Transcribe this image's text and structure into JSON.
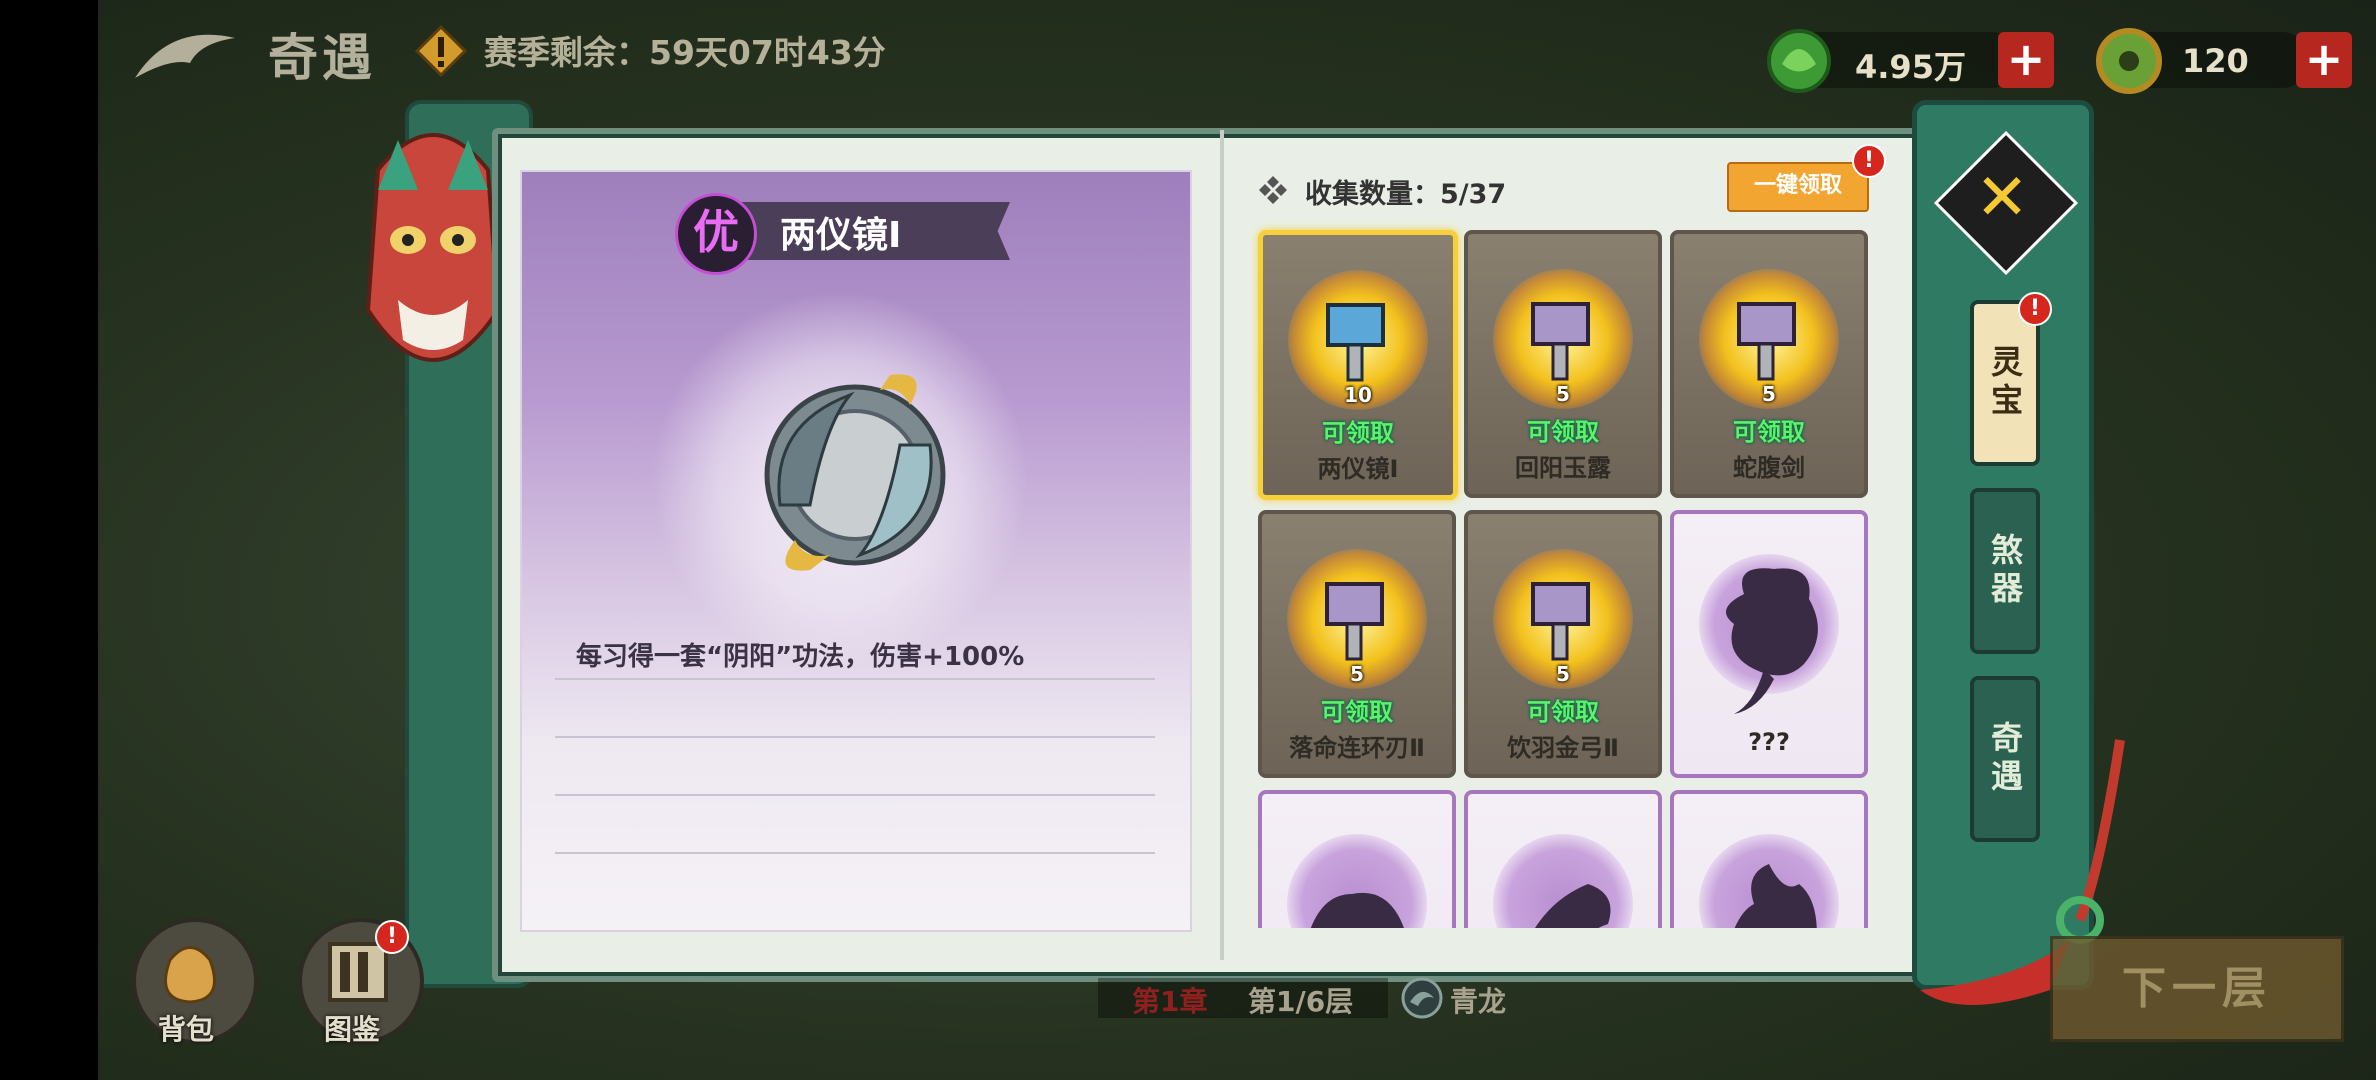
{
  "hud": {
    "title": "奇遇",
    "season_text": "赛季剩余：59天07时43分",
    "currency1": "4.95万",
    "currency2": "120",
    "plus": "+"
  },
  "detail": {
    "rank": "优",
    "name": "两仪镜Ⅰ",
    "description": "每习得一套“阴阳”功法，伤害+100%"
  },
  "collection": {
    "label": "收集数量：",
    "count": "5/37",
    "claim_all": "一键领取",
    "badge": "!"
  },
  "cards": [
    {
      "name": "两仪镜Ⅰ",
      "count": "10",
      "status": "可领取",
      "state": "owned"
    },
    {
      "name": "回阳玉露",
      "count": "5",
      "status": "可领取",
      "state": "owned"
    },
    {
      "name": "蛇腹剑",
      "count": "5",
      "status": "可领取",
      "state": "owned"
    },
    {
      "name": "落命连环刃Ⅱ",
      "count": "5",
      "status": "可领取",
      "state": "owned"
    },
    {
      "name": "饮羽金弓Ⅱ",
      "count": "5",
      "status": "可领取",
      "state": "owned"
    },
    {
      "name": "???",
      "state": "locked"
    }
  ],
  "tabs": [
    {
      "label": "灵宝",
      "active": true
    },
    {
      "label": "煞器",
      "active": false
    },
    {
      "label": "奇遇",
      "active": false
    }
  ],
  "tab_badge": "!",
  "bottom": {
    "bag": "背包",
    "codex": "图鉴",
    "codex_badge": "!",
    "next": "下一层",
    "chapter": "第1章",
    "floor": "第1/6层",
    "boss": "青龙"
  },
  "colors": {
    "accent_green": "#2f7a63",
    "claim_green": "#5cf26a",
    "gold": "#f6cf3a",
    "red": "#d6271e",
    "purple": "#a677bd"
  }
}
